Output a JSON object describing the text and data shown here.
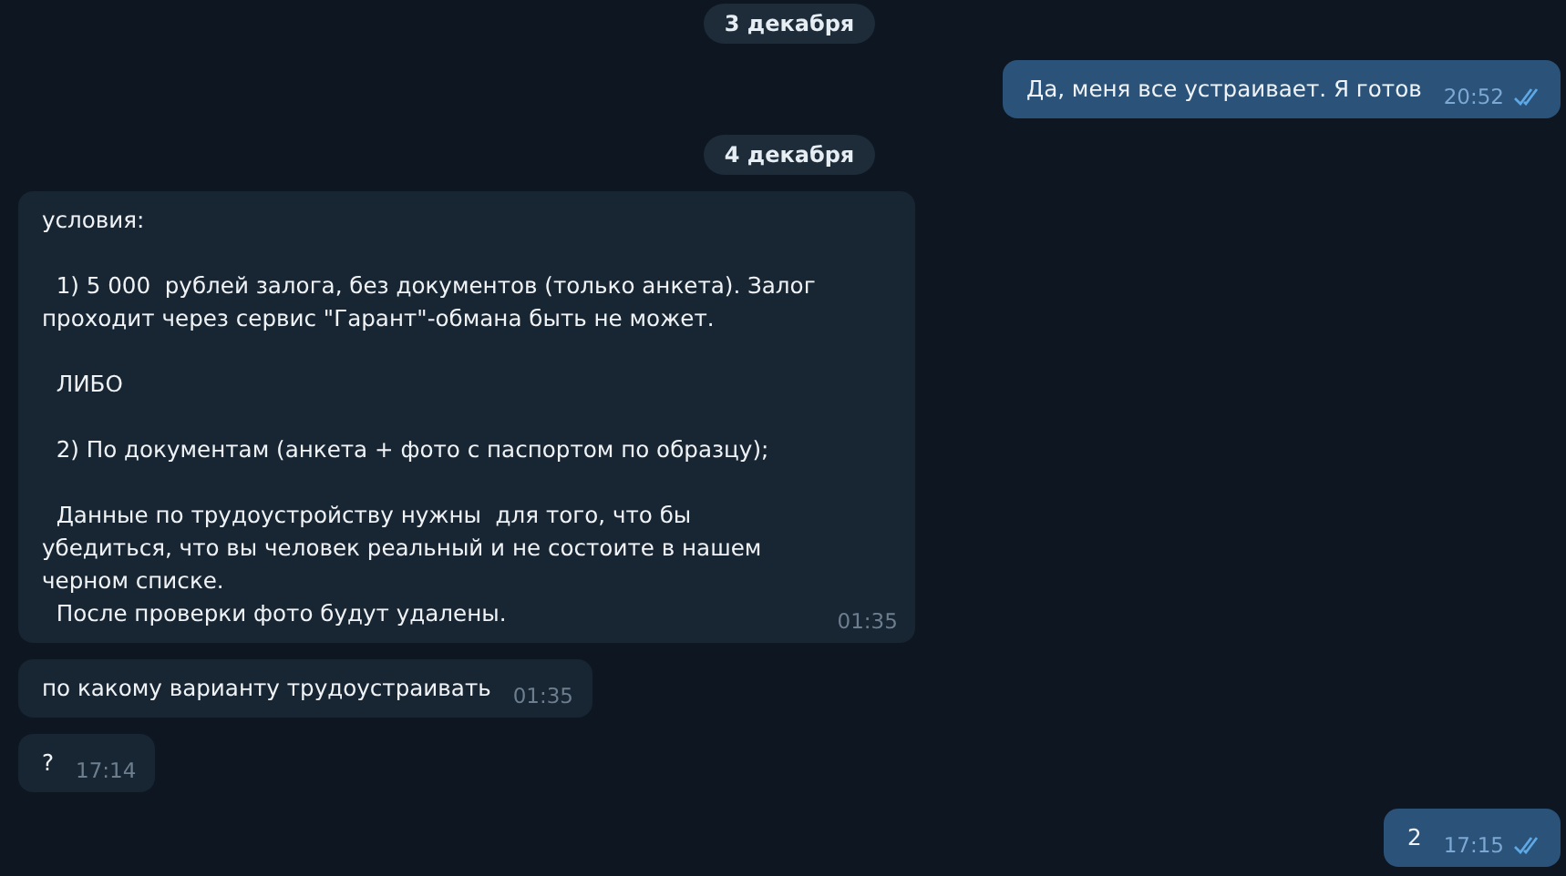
{
  "messages": [
    {
      "kind": "date",
      "text": "3 декабря"
    },
    {
      "kind": "outgoing",
      "text": "Да, меня все устраивает. Я готов",
      "time": "20:52",
      "read": true
    },
    {
      "kind": "date",
      "text": "4 декабря"
    },
    {
      "kind": "incoming",
      "text": "условия:\n\n  1) 5 000  рублей залога, без документов (только анкета). Залог\nпроходит через сервис \"Гарант\"-обмана быть не может.\n\n  ЛИБО\n\n  2) По документам (анкета + фото с паспортом по образцу);\n\n  Данные по трудоустройству нужны  для того, что бы\nубедиться, что вы человек реальный и не состоите в нашем\nчерном списке.\n  После проверки фото будут удалены.",
      "time": "01:35"
    },
    {
      "kind": "incoming",
      "text": "по какому варианту трудоустраивать",
      "time": "01:35"
    },
    {
      "kind": "incoming",
      "text": "?",
      "time": "17:14"
    },
    {
      "kind": "outgoing",
      "text": "2",
      "time": "17:15",
      "read": true
    }
  ]
}
